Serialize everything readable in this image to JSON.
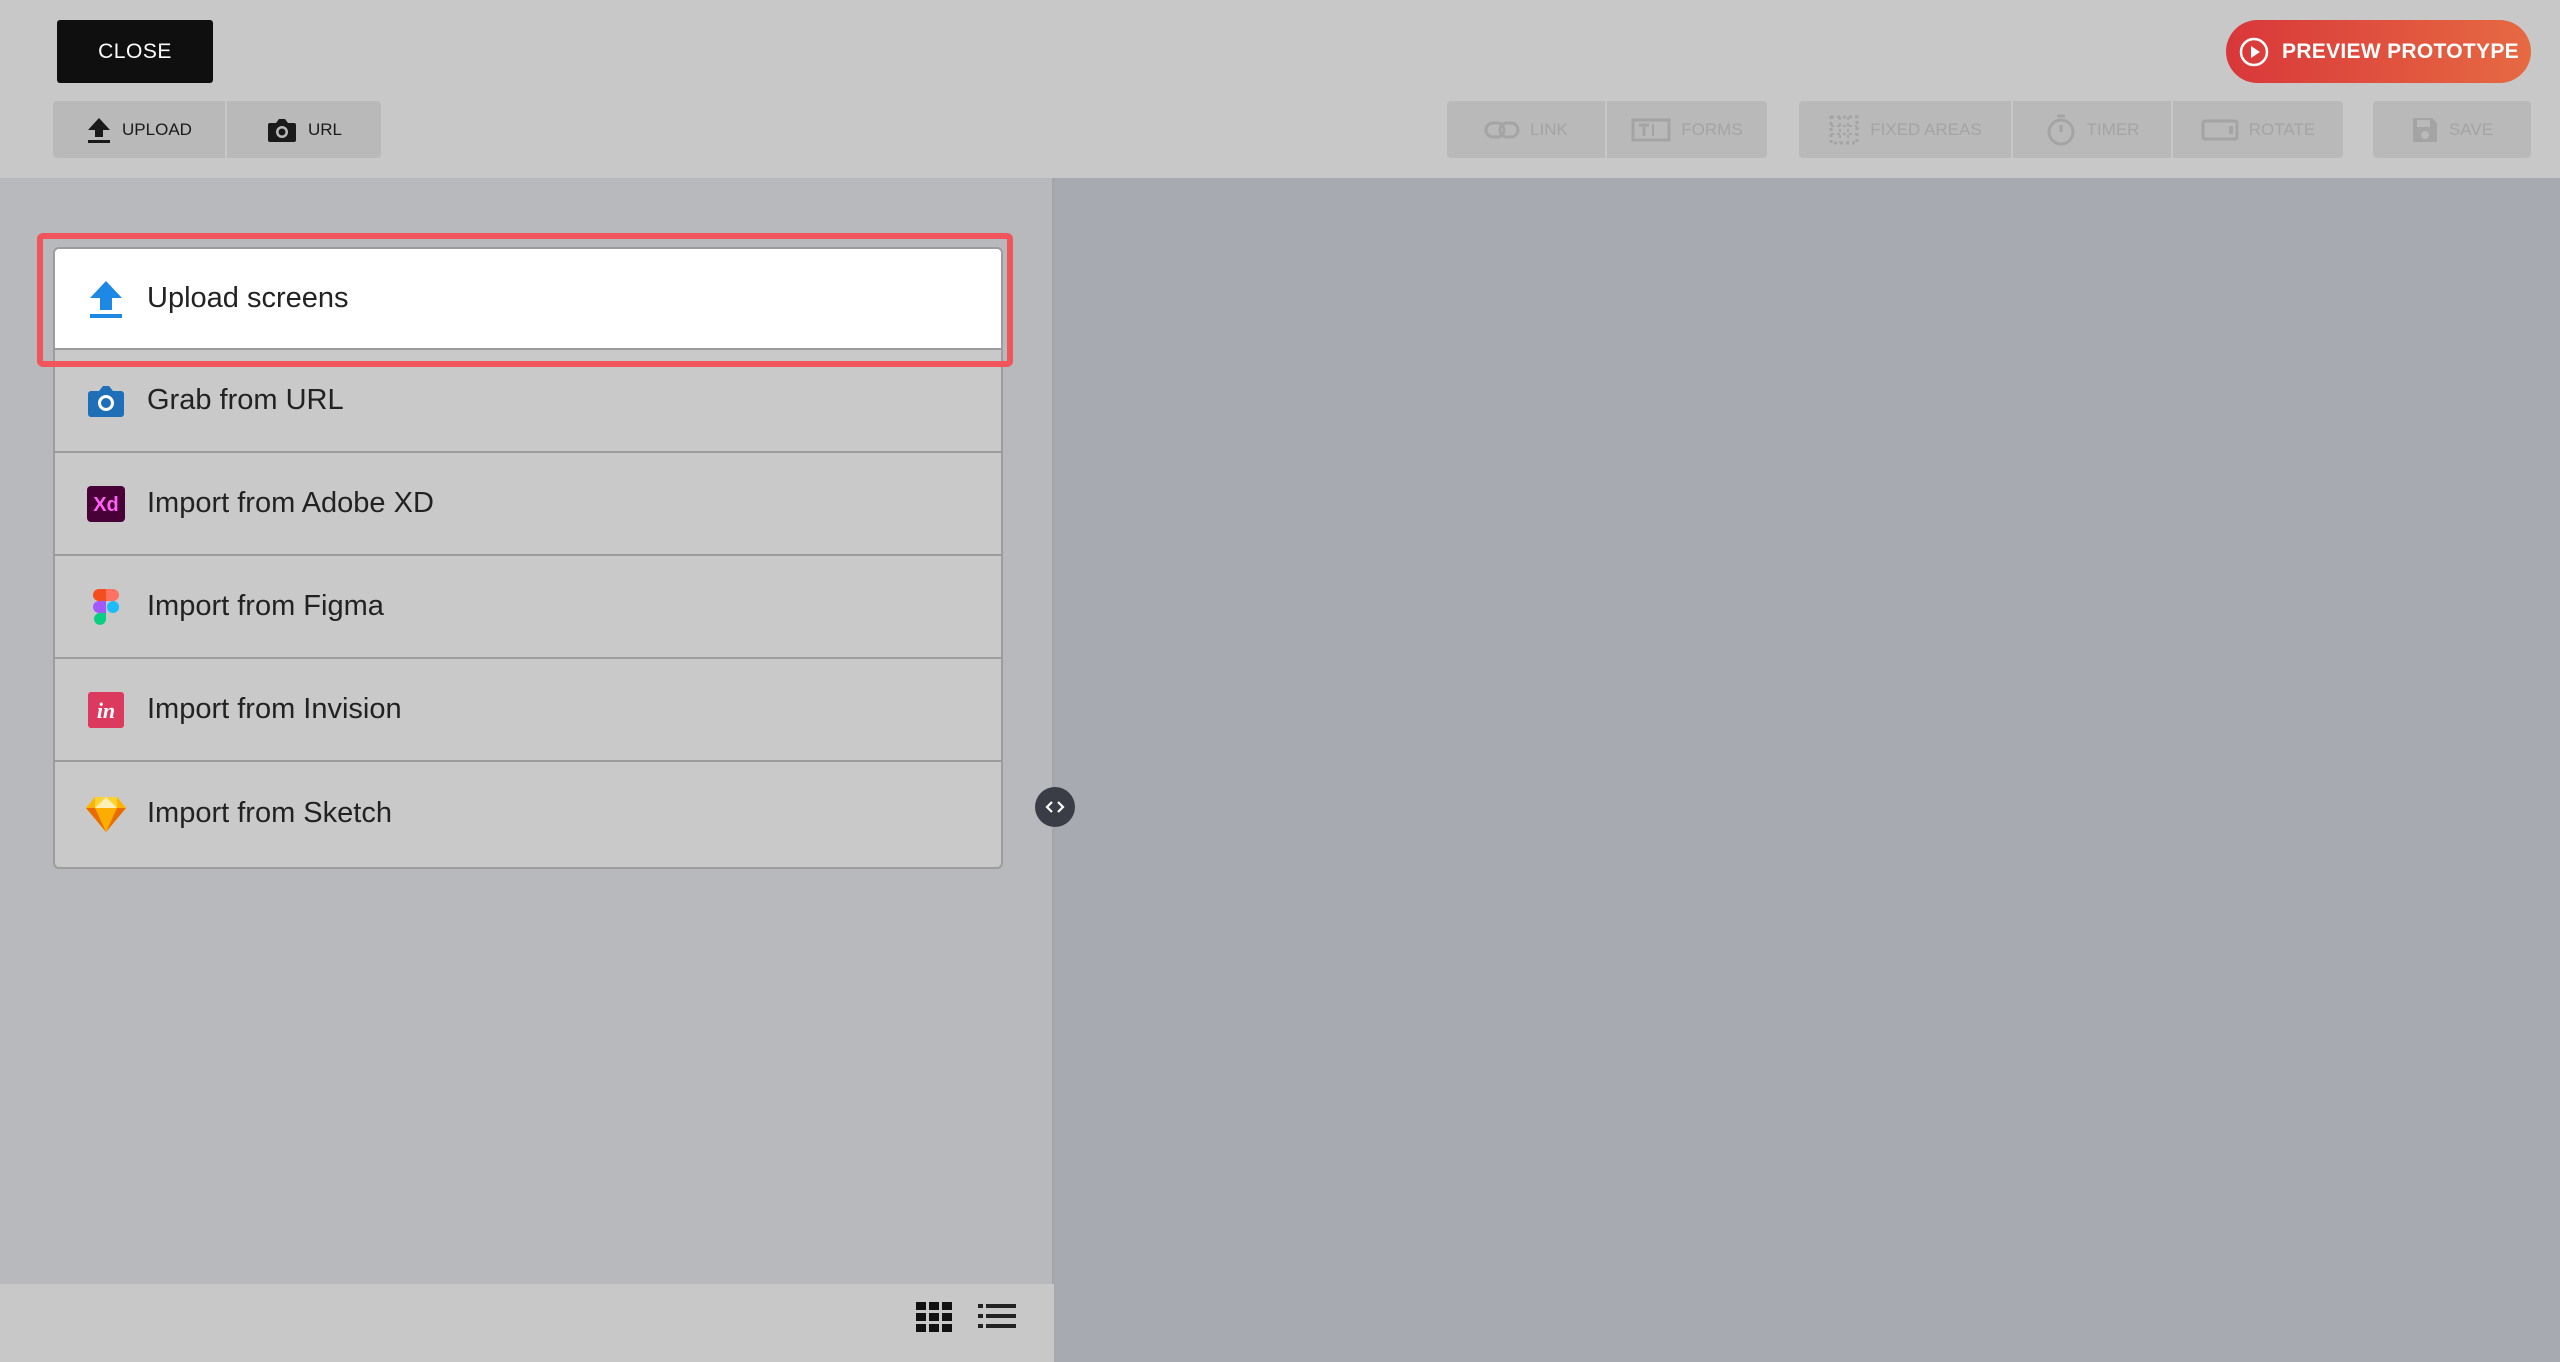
{
  "toolbar": {
    "close_label": "CLOSE",
    "preview_label": "PREVIEW PROTOTYPE",
    "upload_label": "UPLOAD",
    "url_label": "URL",
    "link_label": "LINK",
    "forms_label": "FORMS",
    "fixed_areas_label": "FIXED AREAS",
    "timer_label": "TIMER",
    "rotate_label": "ROTATE",
    "save_label": "SAVE"
  },
  "import_menu": {
    "items": [
      {
        "label": "Upload screens",
        "icon": "upload-icon"
      },
      {
        "label": "Grab from URL",
        "icon": "camera-icon"
      },
      {
        "label": "Import from Adobe XD",
        "icon": "adobe-xd-icon"
      },
      {
        "label": "Import from Figma",
        "icon": "figma-icon"
      },
      {
        "label": "Import from Invision",
        "icon": "invision-icon"
      },
      {
        "label": "Import from Sketch",
        "icon": "sketch-icon"
      }
    ]
  },
  "icons": {
    "xd_text": "Xd",
    "invision_text": "in"
  },
  "colors": {
    "highlight": "#f0555b",
    "preview_gradient_start": "#d9373a",
    "preview_gradient_end": "#e66a42",
    "upload_blue": "#1e88e5"
  }
}
